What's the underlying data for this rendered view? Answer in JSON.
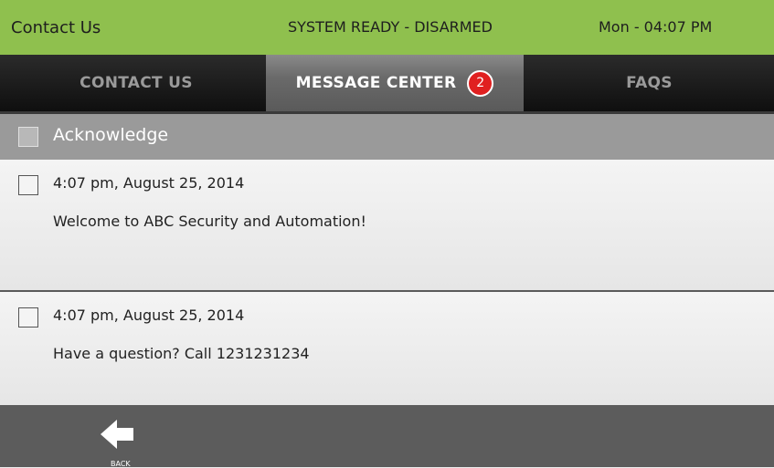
{
  "status": {
    "title": "Contact Us",
    "state": "SYSTEM READY - DISARMED",
    "time": "Mon - 04:07 PM"
  },
  "tabs": [
    {
      "label": "CONTACT US",
      "active": false
    },
    {
      "label": "MESSAGE CENTER",
      "active": true,
      "badge": "2"
    },
    {
      "label": "FAQS",
      "active": false
    }
  ],
  "acknowledge": {
    "label": "Acknowledge",
    "checked": false
  },
  "messages": [
    {
      "date": "4:07 pm, August 25, 2014",
      "text": "Welcome to ABC Security and Automation!",
      "checked": false
    },
    {
      "date": "4:07 pm, August 25, 2014",
      "text": "Have a question? Call 1231231234",
      "checked": false
    }
  ],
  "bottom": {
    "back_label": "BACK"
  },
  "icons": {
    "back": "left-arrow-icon"
  },
  "colors": {
    "status_bar": "#8fc04e",
    "badge": "#e02020"
  }
}
